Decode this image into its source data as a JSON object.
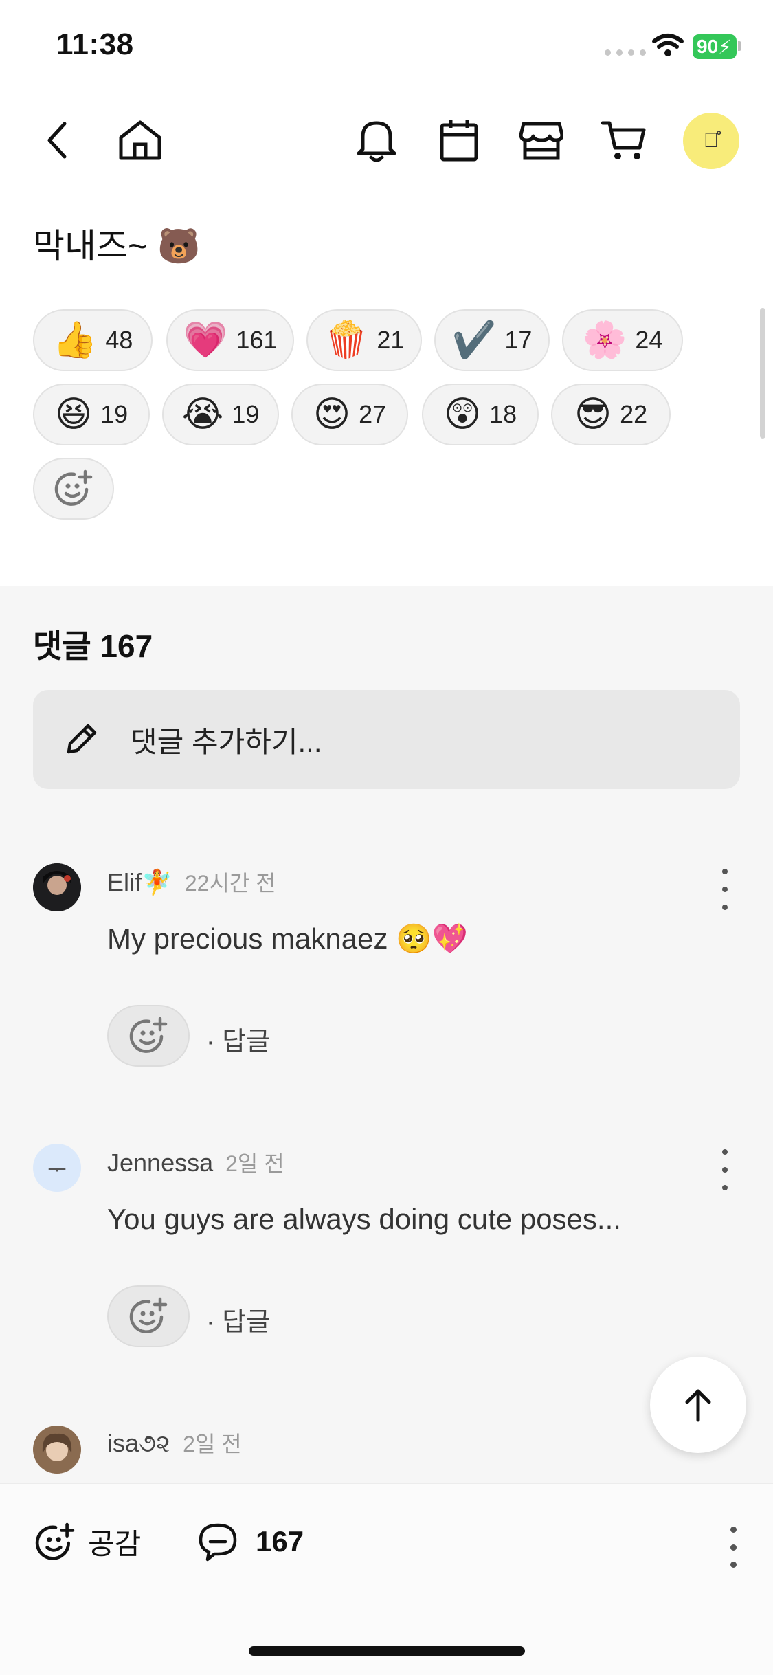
{
  "status_bar": {
    "time": "11:38",
    "battery": "90"
  },
  "nav": {
    "avatar_text": "ᅮ̊"
  },
  "post": {
    "title": "막내즈~ 🐻"
  },
  "reactions": [
    {
      "emoji": "👍",
      "count": "48"
    },
    {
      "emoji": "💗",
      "count": "161"
    },
    {
      "emoji": "🍿",
      "count": "21"
    },
    {
      "emoji": "✔️",
      "count": "17"
    },
    {
      "emoji": "🌸",
      "count": "24"
    },
    {
      "emoji": "😆",
      "count": "19"
    },
    {
      "emoji": "😭",
      "count": "19"
    },
    {
      "emoji": "😍",
      "count": "27"
    },
    {
      "emoji": "😲",
      "count": "18"
    },
    {
      "emoji": "😎",
      "count": "22"
    }
  ],
  "comments_section": {
    "header": "댓글 167",
    "input_placeholder": "댓글 추가하기...",
    "items": [
      {
        "name": "Elif🧚",
        "time": "22시간 전",
        "text": "My precious maknaez 🥺💖",
        "reply": "· 답글"
      },
      {
        "name": "Jennessa",
        "time": "2일 전",
        "text": "You guys are always doing cute poses...",
        "reply": "· 답글"
      },
      {
        "name": "isa૭૨",
        "time": "2일 전",
        "text": "",
        "reply": ""
      }
    ]
  },
  "bottom_bar": {
    "like_label": "공감",
    "comment_count": "167"
  },
  "colors": {
    "avatar_bg": "#f8ec7a",
    "battery": "#34c759",
    "heart": "#ff2fb3"
  }
}
